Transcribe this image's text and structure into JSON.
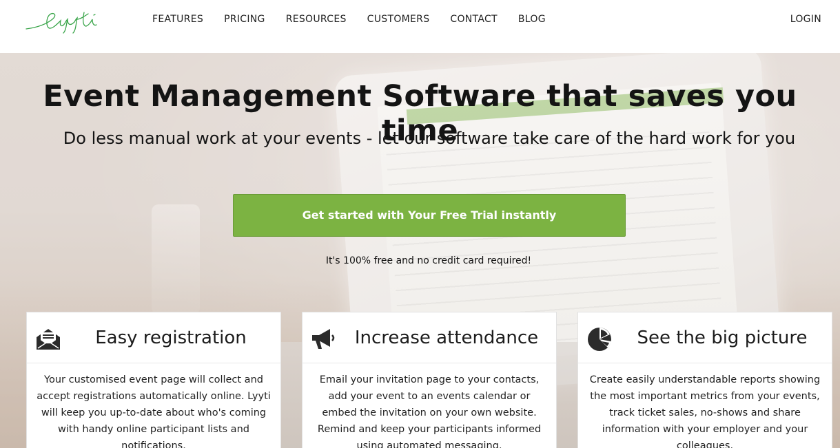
{
  "brand": {
    "logo_text": "Lyyti",
    "accent": "#7cb342",
    "logo_color": "#3aa54a"
  },
  "nav": {
    "items": [
      {
        "label": "FEATURES"
      },
      {
        "label": "PRICING"
      },
      {
        "label": "RESOURCES"
      },
      {
        "label": "CUSTOMERS"
      },
      {
        "label": "CONTACT"
      },
      {
        "label": "BLOG"
      }
    ],
    "login": "LOGIN"
  },
  "hero": {
    "title": "Event Management Software that saves you time",
    "subtitle": "Do less manual work at your events - let our software take care of the hard work for you",
    "cta_label": "Get started with Your Free Trial instantly",
    "note": "It's 100% free and no credit card required!"
  },
  "features": [
    {
      "icon": "envelope-icon",
      "title": "Easy registration",
      "text": "Your customised event page will collect and accept registrations automatically online. Lyyti will keep you up-to-date about who's coming with handy online participant lists and notifications."
    },
    {
      "icon": "megaphone-icon",
      "title": "Increase attendance",
      "text": "Email your invitation page to your contacts, add your event to an events calendar or embed the invitation on your own website. Remind and keep your participants informed using automated messaging."
    },
    {
      "icon": "pie-chart-icon",
      "title": "See the big picture",
      "text": "Create easily understandable reports showing the most important metrics from your events, track ticket sales, no-shows and share information with your employer and your colleagues."
    }
  ]
}
